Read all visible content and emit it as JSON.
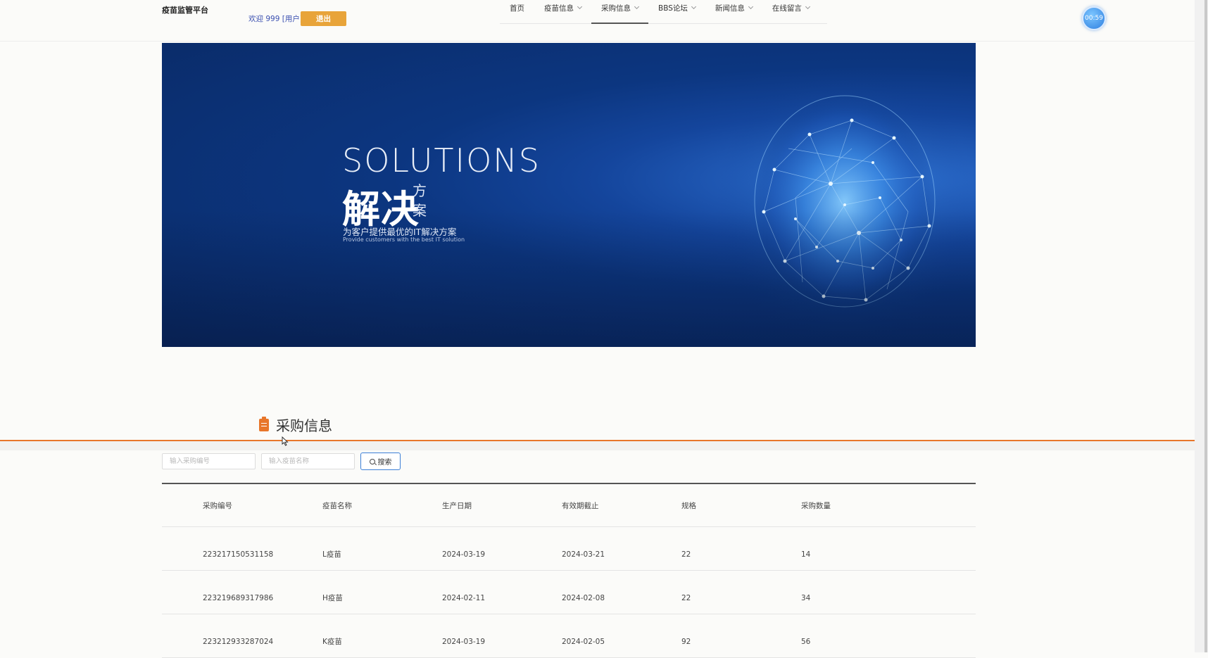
{
  "header": {
    "site_title": "疫苗监管平台",
    "welcome": "欢迎 999 [用户]",
    "logout_label": "退出",
    "timer": "00:59"
  },
  "nav": {
    "items": [
      {
        "label": "首页",
        "has_dropdown": false,
        "active": false
      },
      {
        "label": "疫苗信息",
        "has_dropdown": true,
        "active": false
      },
      {
        "label": "采购信息",
        "has_dropdown": true,
        "active": true
      },
      {
        "label": "BBS论坛",
        "has_dropdown": true,
        "active": false
      },
      {
        "label": "新闻信息",
        "has_dropdown": true,
        "active": false
      },
      {
        "label": "在线留言",
        "has_dropdown": true,
        "active": false
      }
    ]
  },
  "banner": {
    "solutions": "SOLUTIONS",
    "big": "解决",
    "side": "方案",
    "sub": "为客户提供最优的IT解决方案",
    "sub_en": "Provide customers with the best IT solution"
  },
  "section": {
    "title": "采购信息",
    "icon": "clipboard-icon",
    "accent_color": "#e8762a"
  },
  "search": {
    "code_placeholder": "输入采购编号",
    "name_placeholder": "输入疫苗名称",
    "button_label": "搜索"
  },
  "table": {
    "headers": [
      "采购编号",
      "疫苗名称",
      "生产日期",
      "有效期截止",
      "规格",
      "采购数量"
    ],
    "rows": [
      [
        "223217150531158",
        "L疫苗",
        "2024-03-19",
        "2024-03-21",
        "22",
        "14"
      ],
      [
        "223219689317986",
        "H疫苗",
        "2024-02-11",
        "2024-02-08",
        "22",
        "34"
      ],
      [
        "223212933287024",
        "K疫苗",
        "2024-03-19",
        "2024-02-05",
        "92",
        "56"
      ]
    ]
  }
}
